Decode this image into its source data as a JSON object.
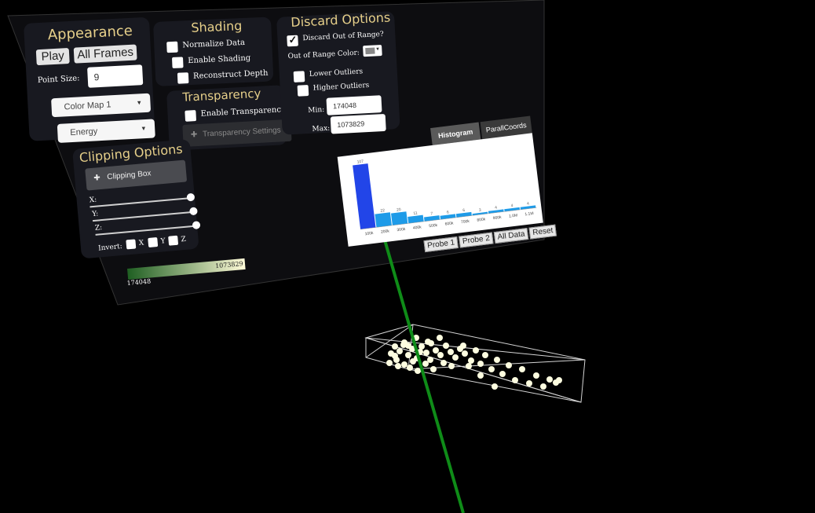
{
  "appearance": {
    "title": "Appearance",
    "play_label": "Play",
    "all_frames_label": "All Frames",
    "point_size_label": "Point Size:",
    "point_size_value": "9",
    "color_map": "Color Map 1",
    "variable": "Energy"
  },
  "shading": {
    "title": "Shading",
    "normalize_label": "Normalize Data",
    "enable_shading_label": "Enable Shading",
    "reconstruct_depth_label": "Reconstruct Depth"
  },
  "transparency": {
    "title": "Transparency",
    "enable_label": "Enable Transparency",
    "settings_label": "Transparency Settings"
  },
  "discard": {
    "title": "Discard Options",
    "out_of_range_label": "Discard Out of Range?",
    "out_of_range_checked": true,
    "out_of_range_color_label": "Out of Range Color:",
    "lower_outliers_label": "Lower Outliers",
    "higher_outliers_label": "Higher Outliers",
    "min_label": "Min:",
    "min_value": "174048",
    "max_label": "Max:",
    "max_value": "1073829"
  },
  "clipping": {
    "title": "Clipping Options",
    "box_label": "Clipping Box",
    "x_label": "X:",
    "y_label": "Y:",
    "z_label": "Z:",
    "invert_label": "Invert:",
    "invert_x": "X",
    "invert_y": "Y",
    "invert_z": "Z"
  },
  "colorbar": {
    "min_label": "174048",
    "max_label": "1073829",
    "start_color": "#1f5f22",
    "end_color": "#fffbd8"
  },
  "histogram": {
    "tabs": [
      "Histogram",
      "ParallCoords"
    ],
    "active_tab": "Histogram",
    "buttons": [
      "Probe 1",
      "Probe 2",
      "All Data",
      "Reset"
    ],
    "highlight_color": "#2245e8",
    "bar_color": "#1e9be8"
  },
  "chart_data": {
    "type": "bar",
    "categories": [
      "100k",
      "200k",
      "300k",
      "400k",
      "500k",
      "600k",
      "700k",
      "800k",
      "900k",
      "1.0M",
      "1.1M"
    ],
    "values": [
      107,
      22,
      20,
      11,
      7,
      6,
      6,
      3,
      4,
      4,
      4
    ],
    "data_labels": [
      "107",
      "22",
      "20",
      "11",
      "7",
      "6",
      "6",
      "3",
      "4",
      "4",
      "4"
    ],
    "highlight_index": 0
  },
  "scene": {
    "point_color": "#fdfde0",
    "wire_color": "#d9d9d9",
    "ray_color": "#0c8a14"
  }
}
